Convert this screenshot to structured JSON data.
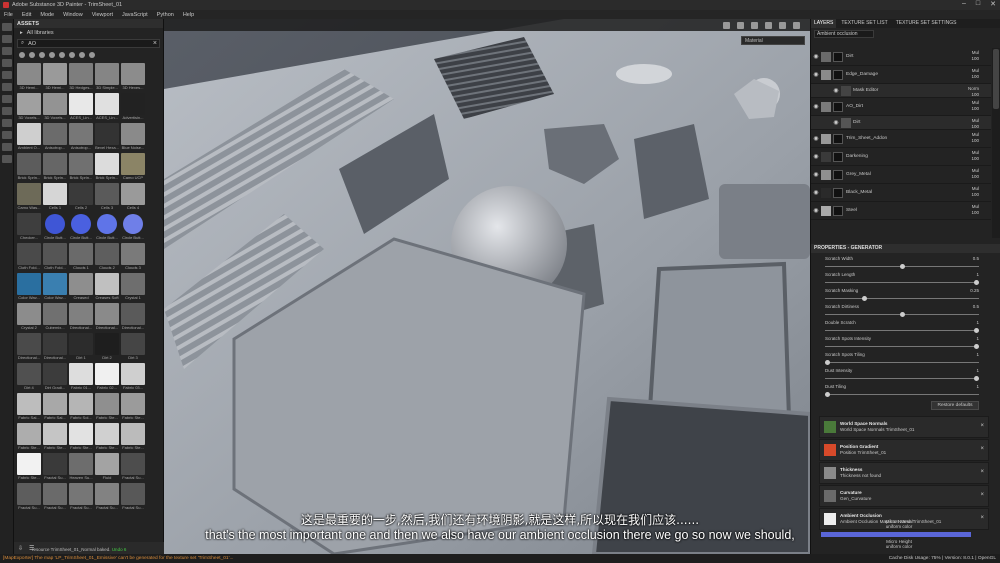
{
  "window": {
    "title": "Adobe Substance 3D Painter - TrimSheet_01",
    "controls": [
      "–",
      "□",
      "✕"
    ]
  },
  "menu": [
    "File",
    "Edit",
    "Mode",
    "Window",
    "Viewport",
    "JavaScript",
    "Python",
    "Help"
  ],
  "assets": {
    "title": "ASSETS",
    "library": "All libraries",
    "search_value": "AO",
    "footer_icons": [
      "import-icon",
      "refresh-icon",
      "settings-icon",
      "add-icon"
    ],
    "items": [
      {
        "label": "3D Hemi...",
        "color": "#8a8a8a"
      },
      {
        "label": "3D Hemi...",
        "color": "#9a9a9a"
      },
      {
        "label": "3D Hedges...",
        "color": "#7d7d7d"
      },
      {
        "label": "3D Simple...",
        "color": "#858585"
      },
      {
        "label": "3D Hexes...",
        "color": "#8c8c8c"
      },
      {
        "label": "3D Voxels...",
        "color": "#a0a0a0"
      },
      {
        "label": "3D Voxels...",
        "color": "#939393"
      },
      {
        "label": "ACES_Lin...",
        "color": "#e8e8e8"
      },
      {
        "label": "ACES_Lin...",
        "color": "#e0e0e0"
      },
      {
        "label": "Advertisin...",
        "color": "#222222"
      },
      {
        "label": "Ambient O...",
        "color": "#cfcfcf"
      },
      {
        "label": "Anisotrop...",
        "color": "#6b6b6b"
      },
      {
        "label": "Anisotrop...",
        "color": "#777777"
      },
      {
        "label": "Bevel Hexa...",
        "color": "#333333"
      },
      {
        "label": "Blue Noise...",
        "color": "#8a8a8a"
      },
      {
        "label": "Brick Sprin...",
        "color": "#5c5c5c"
      },
      {
        "label": "Brick Sprin...",
        "color": "#666666"
      },
      {
        "label": "Brick Sprin...",
        "color": "#707070"
      },
      {
        "label": "Brick Sprin...",
        "color": "#dcdcdc"
      },
      {
        "label": "Camo UCP",
        "color": "#8b8466"
      },
      {
        "label": "Camo Was...",
        "color": "#6d6a58"
      },
      {
        "label": "Cells 1",
        "color": "#d6d6d6"
      },
      {
        "label": "Cells 2",
        "color": "#3a3a3a"
      },
      {
        "label": "Cells 3",
        "color": "#5a5a5a"
      },
      {
        "label": "Cells 4",
        "color": "#9a9a9a"
      },
      {
        "label": "Checker...",
        "color": "#3e3e3e"
      },
      {
        "label": "Circle Butt...",
        "color": "#3f56d6"
      },
      {
        "label": "Circle Butt...",
        "color": "#4a60e0"
      },
      {
        "label": "Circle Butt...",
        "color": "#5f74e8"
      },
      {
        "label": "Circle Butt...",
        "color": "#6f7fe8"
      },
      {
        "label": "Cloth Fold...",
        "color": "#4a4a4a"
      },
      {
        "label": "Cloth Fold...",
        "color": "#555555"
      },
      {
        "label": "Clouds 1",
        "color": "#6a6a6a"
      },
      {
        "label": "Clouds 2",
        "color": "#5e5e5e"
      },
      {
        "label": "Clouds 3",
        "color": "#7a7a7a"
      },
      {
        "label": "Color Wav...",
        "color": "#2a6fa0"
      },
      {
        "label": "Color Wav...",
        "color": "#3a7fb0"
      },
      {
        "label": "Creased",
        "color": "#8e8e8e"
      },
      {
        "label": "Creases Soft",
        "color": "#c0c0c0"
      },
      {
        "label": "Crystal 1",
        "color": "#6e6e6e"
      },
      {
        "label": "Crystal 2",
        "color": "#8c8c8c"
      },
      {
        "label": "Cubemix...",
        "color": "#707070"
      },
      {
        "label": "Directional...",
        "color": "#808080"
      },
      {
        "label": "Directional...",
        "color": "#8a8a8a"
      },
      {
        "label": "Directional...",
        "color": "#5a5a5a"
      },
      {
        "label": "Directional...",
        "color": "#4a4a4a"
      },
      {
        "label": "Directional...",
        "color": "#3a3a3a"
      },
      {
        "label": "Dirt 1",
        "color": "#2c2c2c"
      },
      {
        "label": "Dirt 2",
        "color": "#1e1e1e"
      },
      {
        "label": "Dirt 3",
        "color": "#454545"
      },
      {
        "label": "Dirt 4",
        "color": "#505050"
      },
      {
        "label": "Dirt Gradi...",
        "color": "#3c3c3c"
      },
      {
        "label": "Fabric 01...",
        "color": "#dddddd"
      },
      {
        "label": "Fabric 02...",
        "color": "#f0f0f0"
      },
      {
        "label": "Fabric 03...",
        "color": "#cfcfcf"
      },
      {
        "label": "Fabric Sal...",
        "color": "#bdbdbd"
      },
      {
        "label": "Fabric Sal...",
        "color": "#a8a8a8"
      },
      {
        "label": "Fabric Sol...",
        "color": "#b5b5b5"
      },
      {
        "label": "Fabric Ste...",
        "color": "#8f8f8f"
      },
      {
        "label": "Fabric Ste...",
        "color": "#9b9b9b"
      },
      {
        "label": "Fabric Ste...",
        "color": "#adadad"
      },
      {
        "label": "Fabric Ste...",
        "color": "#c5c5c5"
      },
      {
        "label": "Fabric Ste...",
        "color": "#e2e2e2"
      },
      {
        "label": "Fabric Ste...",
        "color": "#d0d0d0"
      },
      {
        "label": "Fabric Ste...",
        "color": "#bbbbbb"
      },
      {
        "label": "Fabric Ste...",
        "color": "#f2f2f2"
      },
      {
        "label": "Fractal Su...",
        "color": "#3a3a3a"
      },
      {
        "label": "Heaven Su...",
        "color": "#6d6d6d"
      },
      {
        "label": "Fluid",
        "color": "#a3a3a3"
      },
      {
        "label": "Fractal Su...",
        "color": "#4d4d4d"
      },
      {
        "label": "Fractal Su...",
        "color": "#5d5d5d"
      },
      {
        "label": "Fractal Su...",
        "color": "#6a6a6a"
      },
      {
        "label": "Fractal Su...",
        "color": "#767676"
      },
      {
        "label": "Fractal Su...",
        "color": "#828282"
      },
      {
        "label": "Fractal Su...",
        "color": "#585858"
      }
    ]
  },
  "viewport": {
    "material_select": "Material"
  },
  "layers_panel": {
    "tabs": [
      "LAYERS",
      "TEXTURE SET LIST",
      "TEXTURE SET SETTINGS"
    ],
    "channel": "Ambient occlusion",
    "layers": [
      {
        "name": "Dirt",
        "blend": "Mul",
        "opacity": "100",
        "sub": false,
        "thumb": "#6a6a6a"
      },
      {
        "name": "Edge_Damage",
        "blend": "Mul",
        "opacity": "100",
        "sub": false,
        "thumb": "#8a8a8a"
      },
      {
        "name": "Mask Editor",
        "blend": "Norm",
        "opacity": "100",
        "sub": true,
        "thumb": "#444444"
      },
      {
        "name": "AO_Dirt",
        "blend": "Mul",
        "opacity": "100",
        "sub": false,
        "thumb": "#7a7a7a"
      },
      {
        "name": "Dirt",
        "blend": "Mul",
        "opacity": "100",
        "sub": true,
        "thumb": "#555555"
      },
      {
        "name": "Trim_Sheet_Addon",
        "blend": "Mul",
        "opacity": "100",
        "sub": false,
        "thumb": "#999999"
      },
      {
        "name": "Darkening",
        "blend": "Mul",
        "opacity": "100",
        "sub": false,
        "thumb": "#3a3a3a"
      },
      {
        "name": "Grey_Metal",
        "blend": "Mul",
        "opacity": "100",
        "sub": false,
        "thumb": "#8f8f8f"
      },
      {
        "name": "Black_Metal",
        "blend": "Mul",
        "opacity": "100",
        "sub": false,
        "thumb": "#2a2a2a"
      },
      {
        "name": "Steel",
        "blend": "Mul",
        "opacity": "100",
        "sub": false,
        "thumb": "#aaaaaa"
      }
    ]
  },
  "properties": {
    "title": "PROPERTIES - GENERATOR",
    "params": [
      {
        "label": "Scratch Width",
        "value": "0.5",
        "level": 0.5
      },
      {
        "label": "Scratch Length",
        "value": "1",
        "level": 1.0
      },
      {
        "label": "Scratch Masking",
        "value": "0.25",
        "level": 0.25
      },
      {
        "label": "Scratch Dirtiness",
        "value": "0.5",
        "level": 0.5
      },
      {
        "label": "Double Scratch",
        "value": "1",
        "level": 1.0
      },
      {
        "label": "Scratch Spots Intensity",
        "value": "1",
        "level": 1.0
      },
      {
        "label": "Scratch Spots Tiling",
        "value": "1",
        "level": 0.0
      },
      {
        "label": "Dust Intensity",
        "value": "1",
        "level": 1.0
      },
      {
        "label": "Dust Tiling",
        "value": "1",
        "level": 0.0
      }
    ],
    "restore_label": "Restore defaults",
    "slots": [
      {
        "title": "World Space Normals",
        "sub": "World Space Normals TrimSheet_01",
        "color": "#4a7a3a"
      },
      {
        "title": "Position Gradient",
        "sub": "Position TrimSheet_01",
        "color": "#d84a2a"
      },
      {
        "title": "Thickness",
        "sub": "Thickness not found",
        "color": "#8a8a8a"
      },
      {
        "title": "Curvature",
        "sub": "Gen_Curvature",
        "color": "#6a6a6a"
      },
      {
        "title": "Ambient Occlusion",
        "sub": "Ambient Occlusion Map from Mesh TrimSheet_01",
        "color": "#eeeeee"
      }
    ],
    "micro_normal": {
      "title": "Micro Normal",
      "sub": "uniform color"
    },
    "micro_height": {
      "title": "Micro Height",
      "sub": "uniform color"
    }
  },
  "resource_bar": {
    "text": "resource TrimSheet_01_Normal baked.",
    "status": "Undo 6"
  },
  "status": {
    "error": "[MapExporter] The map 'LP_TrimSheet_01_Emissive' can't be generated for the texture set 'TrimSheet_01'...",
    "right": "Cache Disk Usage:   75%  |  Version: 8.0.1  |  OpenGL"
  },
  "subtitles": {
    "cn": "这是最重要的一步,然后,我们还有环境阴影,就是这样,所以现在我们应该......",
    "en": "that's the most important one and then we also have our ambient occlusion there we go so now we should,"
  }
}
